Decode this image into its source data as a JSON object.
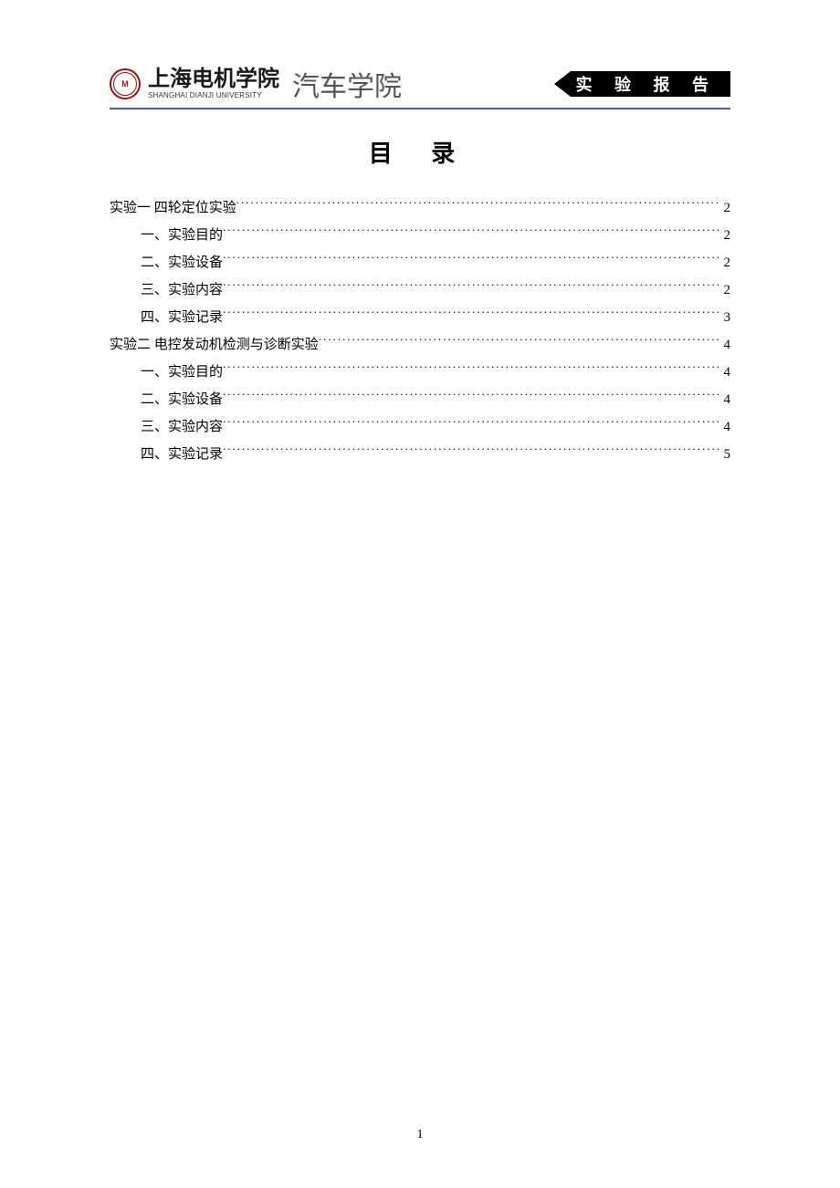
{
  "header": {
    "university_cn": "上海电机学院",
    "university_en": "SHANGHAI DIANJI UNIVERSITY",
    "college": "汽车学院",
    "badge": "实 验 报 告",
    "seal_letter": "M"
  },
  "title": "目 录",
  "toc": [
    {
      "label": "实验一   四轮定位实验",
      "page": "2",
      "indent": false
    },
    {
      "label": "一、实验目的",
      "page": "2",
      "indent": true
    },
    {
      "label": "二、实验设备",
      "page": "2",
      "indent": true
    },
    {
      "label": "三、实验内容",
      "page": "2",
      "indent": true
    },
    {
      "label": "四、实验记录",
      "page": "3",
      "indent": true
    },
    {
      "label": "实验二  电控发动机检测与诊断实验",
      "page": "4",
      "indent": false
    },
    {
      "label": "一、实验目的",
      "page": "4",
      "indent": true
    },
    {
      "label": "二、实验设备",
      "page": "4",
      "indent": true
    },
    {
      "label": "三、实验内容",
      "page": "4",
      "indent": true
    },
    {
      "label": "四、实验记录",
      "page": "5",
      "indent": true
    }
  ],
  "page_number": "1"
}
